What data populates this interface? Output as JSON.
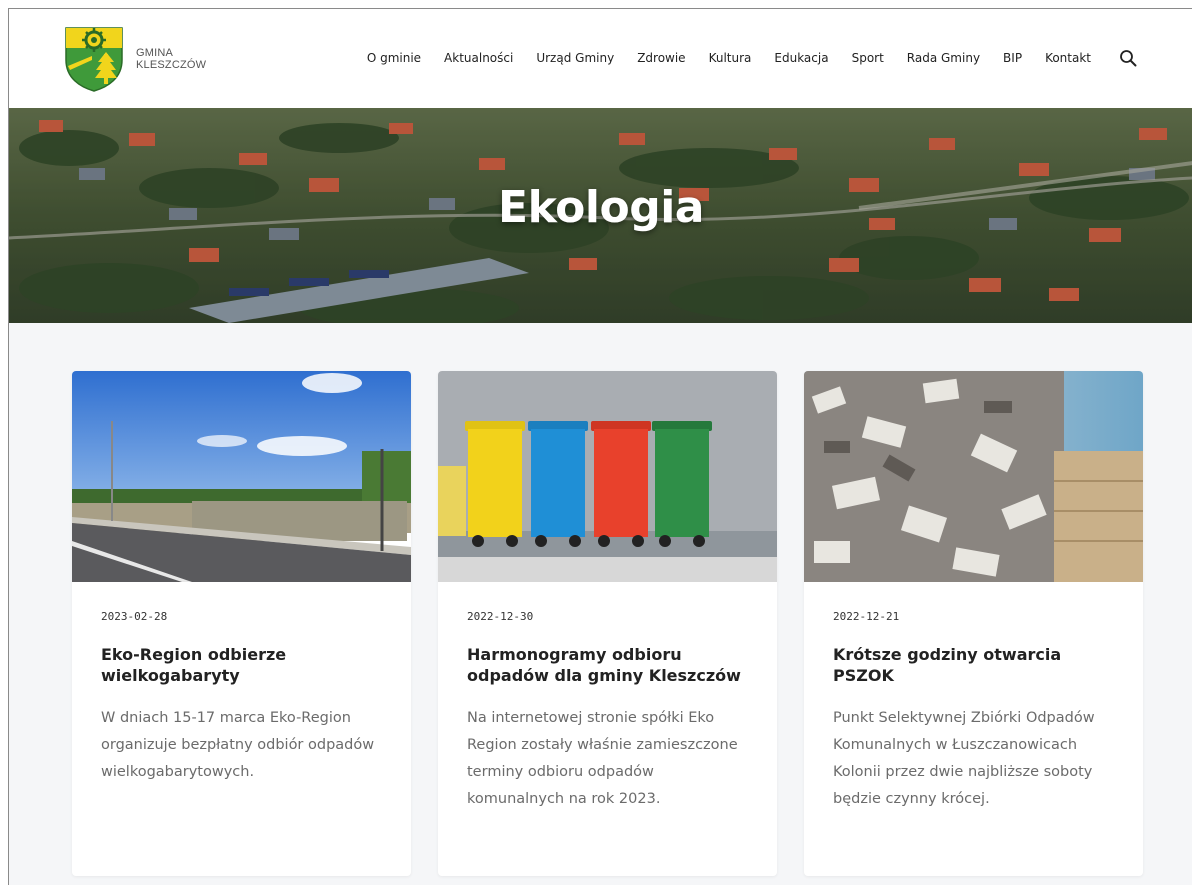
{
  "header": {
    "logo_line1": "GMINA",
    "logo_line2": "KLESZCZÓW",
    "nav": [
      {
        "label": "O gminie"
      },
      {
        "label": "Aktualności"
      },
      {
        "label": "Urząd Gminy"
      },
      {
        "label": "Zdrowie"
      },
      {
        "label": "Kultura"
      },
      {
        "label": "Edukacja"
      },
      {
        "label": "Sport"
      },
      {
        "label": "Rada Gminy"
      },
      {
        "label": "BIP"
      },
      {
        "label": "Kontakt"
      }
    ],
    "search_icon": "search-icon"
  },
  "hero": {
    "title": "Ekologia"
  },
  "articles": [
    {
      "date": "2023-02-28",
      "title": "Eko-Region odbierze wielkogabaryty",
      "excerpt": "W dniach 15-17 marca Eko-Region organizuje bezpłatny odbiór odpadów wielkogabarytowych."
    },
    {
      "date": "2022-12-30",
      "title": "Harmonogramy odbioru odpadów dla gminy Kleszczów",
      "excerpt": "Na internetowej stronie spółki Eko Region zostały właśnie zamieszczone terminy odbioru odpadów komunalnych na rok 2023."
    },
    {
      "date": "2022-12-21",
      "title": "Krótsze godziny otwarcia PSZOK",
      "excerpt": "Punkt Selektywnej Zbiórki Odpadów Komunalnych w Łuszczanowicach Kolonii przez dwie najbliższe soboty będzie czynny krócej."
    }
  ],
  "colors": {
    "page_bg": "#f5f6f8",
    "bin_yellow": "#f2d21b",
    "bin_blue": "#1f8fd6",
    "bin_red": "#e8412c",
    "bin_green": "#2f8f48"
  }
}
